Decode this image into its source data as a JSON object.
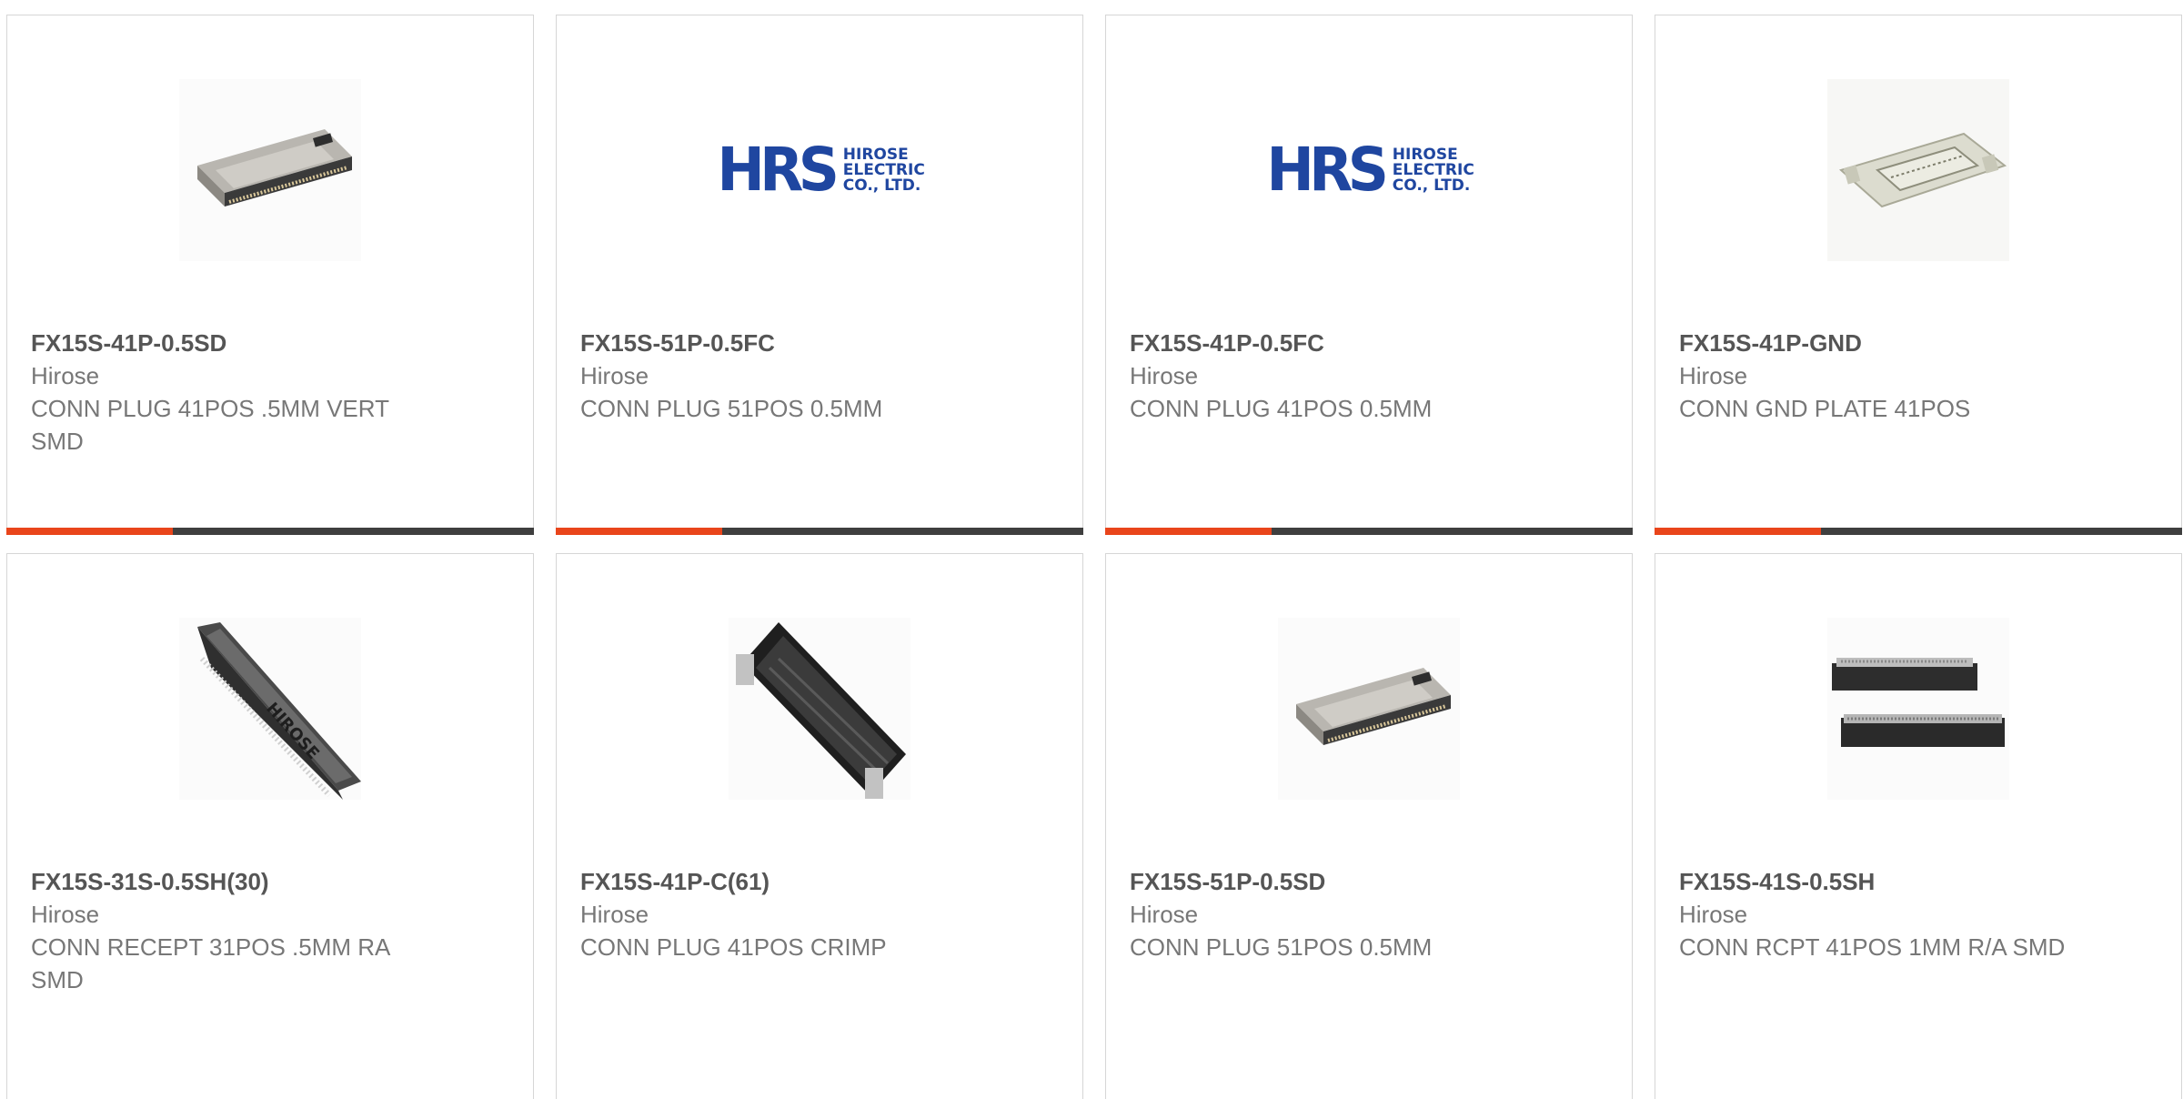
{
  "products": [
    {
      "part_number": "FX15S-41P-0.5SD",
      "manufacturer": "Hirose",
      "description": "CONN PLUG 41POS .5MM VERT SMD",
      "image": "connector-plug-photo"
    },
    {
      "part_number": "FX15S-51P-0.5FC",
      "manufacturer": "Hirose",
      "description": "CONN PLUG 51POS 0.5MM",
      "image": "hrs-logo"
    },
    {
      "part_number": "FX15S-41P-0.5FC",
      "manufacturer": "Hirose",
      "description": "CONN PLUG 41POS 0.5MM",
      "image": "hrs-logo"
    },
    {
      "part_number": "FX15S-41P-GND",
      "manufacturer": "Hirose",
      "description": "CONN GND PLATE 41POS",
      "image": "ground-plate-photo"
    },
    {
      "part_number": "FX15S-31S-0.5SH(30)",
      "manufacturer": "Hirose",
      "description": "CONN RECEPT 31POS .5MM RA SMD",
      "image": "receptacle-photo"
    },
    {
      "part_number": "FX15S-41P-C(61)",
      "manufacturer": "Hirose",
      "description": "CONN PLUG 41POS CRIMP",
      "image": "crimp-plug-photo"
    },
    {
      "part_number": "FX15S-51P-0.5SD",
      "manufacturer": "Hirose",
      "description": "CONN PLUG 51POS 0.5MM",
      "image": "connector-plug-photo"
    },
    {
      "part_number": "FX15S-41S-0.5SH",
      "manufacturer": "Hirose",
      "description": "CONN RCPT 41POS 1MM R/A SMD",
      "image": "receptacle-pair-photo"
    }
  ],
  "logo": {
    "mark": "HRS",
    "line1": "HIROSE",
    "line2": "ELECTRIC",
    "line3": "CO., LTD."
  },
  "colors": {
    "accent": "#e9451b",
    "bar": "#3f3f3f",
    "logo_blue": "#1f46a0"
  }
}
